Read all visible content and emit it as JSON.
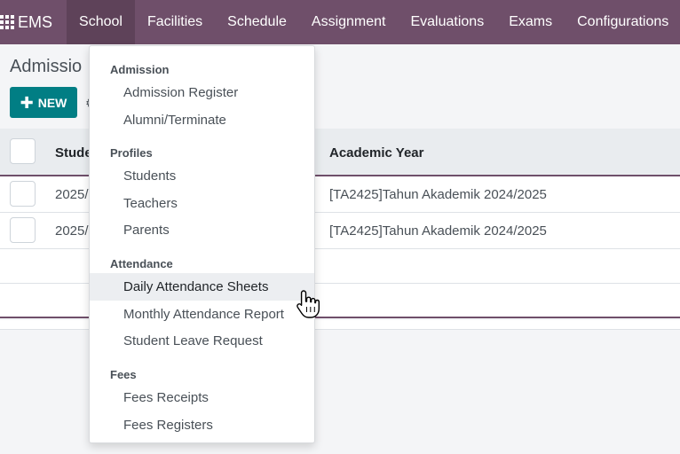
{
  "navbar": {
    "brand": "EMS",
    "menus": [
      "School",
      "Facilities",
      "Schedule",
      "Assignment",
      "Evaluations",
      "Exams",
      "Configurations"
    ],
    "active_menu": "School"
  },
  "control_panel": {
    "title": "Admissio",
    "new_label": "NEW",
    "hint_glyph": "⚙"
  },
  "table": {
    "columns": [
      "Stude",
      "Academic Year"
    ],
    "rows": [
      {
        "num": "2025/",
        "year": "[TA2425]Tahun Akademik 2024/2025"
      },
      {
        "num": "2025/",
        "year": "[TA2425]Tahun Akademik 2024/2025"
      }
    ]
  },
  "dropdown": {
    "sections": [
      {
        "header": "Admission",
        "items": [
          "Admission Register",
          "Alumni/Terminate"
        ]
      },
      {
        "header": "Profiles",
        "items": [
          "Students",
          "Teachers",
          "Parents"
        ]
      },
      {
        "header": "Attendance",
        "items": [
          "Daily Attendance Sheets",
          "Monthly Attendance Report",
          "Student Leave Request"
        ]
      },
      {
        "header": "Fees",
        "items": [
          "Fees Receipts",
          "Fees Registers"
        ]
      }
    ],
    "hovered_item": "Daily Attendance Sheets"
  },
  "colors": {
    "navbar": "#6f4f6a",
    "navbar_active": "#5e4259",
    "primary_button": "#017e84"
  },
  "icons": {
    "apps": "apps-grid-icon",
    "cursor": "hand-pointer-icon"
  }
}
